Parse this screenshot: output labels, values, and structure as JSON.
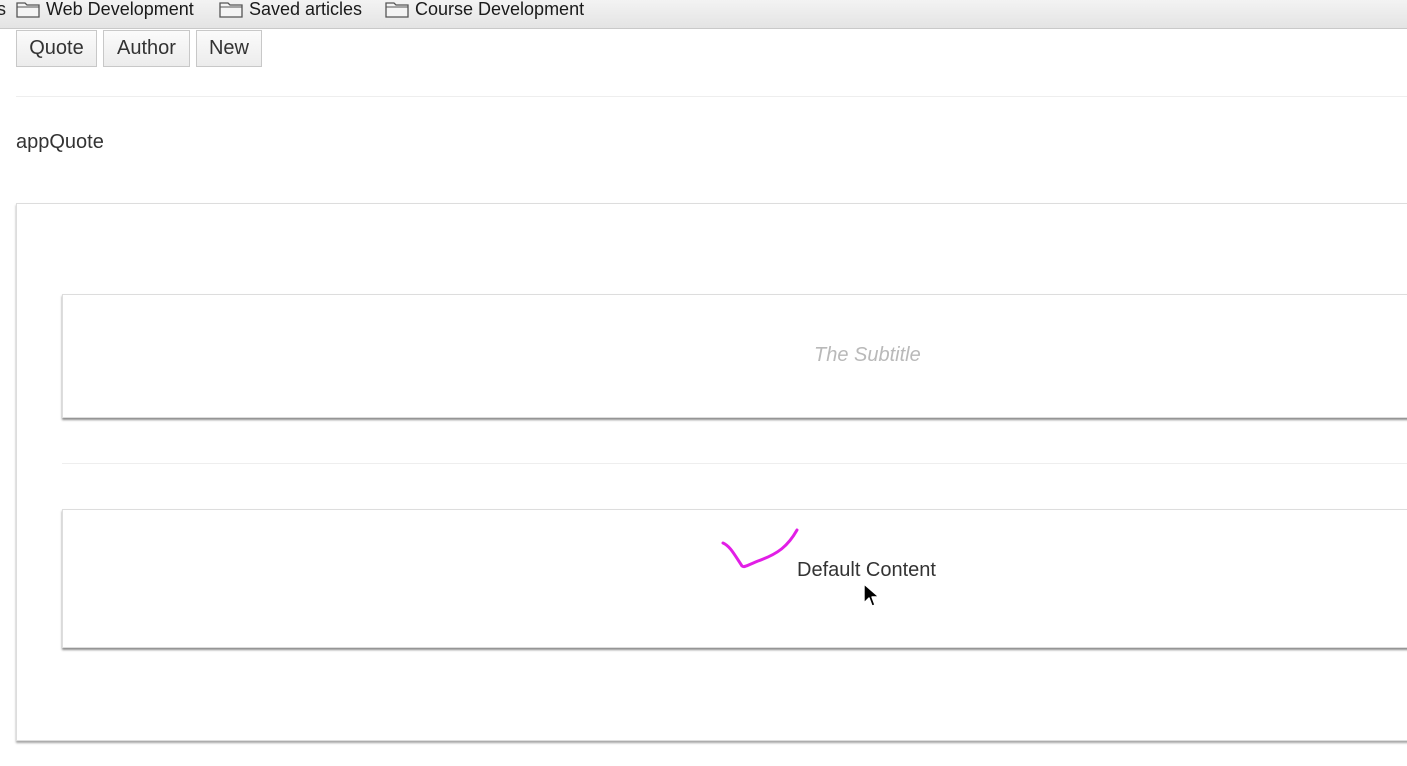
{
  "bookmarks_bar": {
    "edge_fragment": "s",
    "items": [
      {
        "label": "Web Development",
        "icon": "folder-icon"
      },
      {
        "label": "Saved articles",
        "icon": "folder-icon"
      },
      {
        "label": "Course Development",
        "icon": "folder-icon"
      }
    ]
  },
  "toolbar": {
    "buttons": [
      {
        "label": "Quote"
      },
      {
        "label": "Author"
      },
      {
        "label": "New"
      }
    ]
  },
  "main": {
    "component_label": "appQuote",
    "subtitle_card": {
      "text": "The Subtitle"
    },
    "content_card": {
      "text": "Default Content"
    }
  },
  "overlay": {
    "annotation_color": "#e21ee6",
    "cursor_icon": "arrow-cursor-icon"
  }
}
